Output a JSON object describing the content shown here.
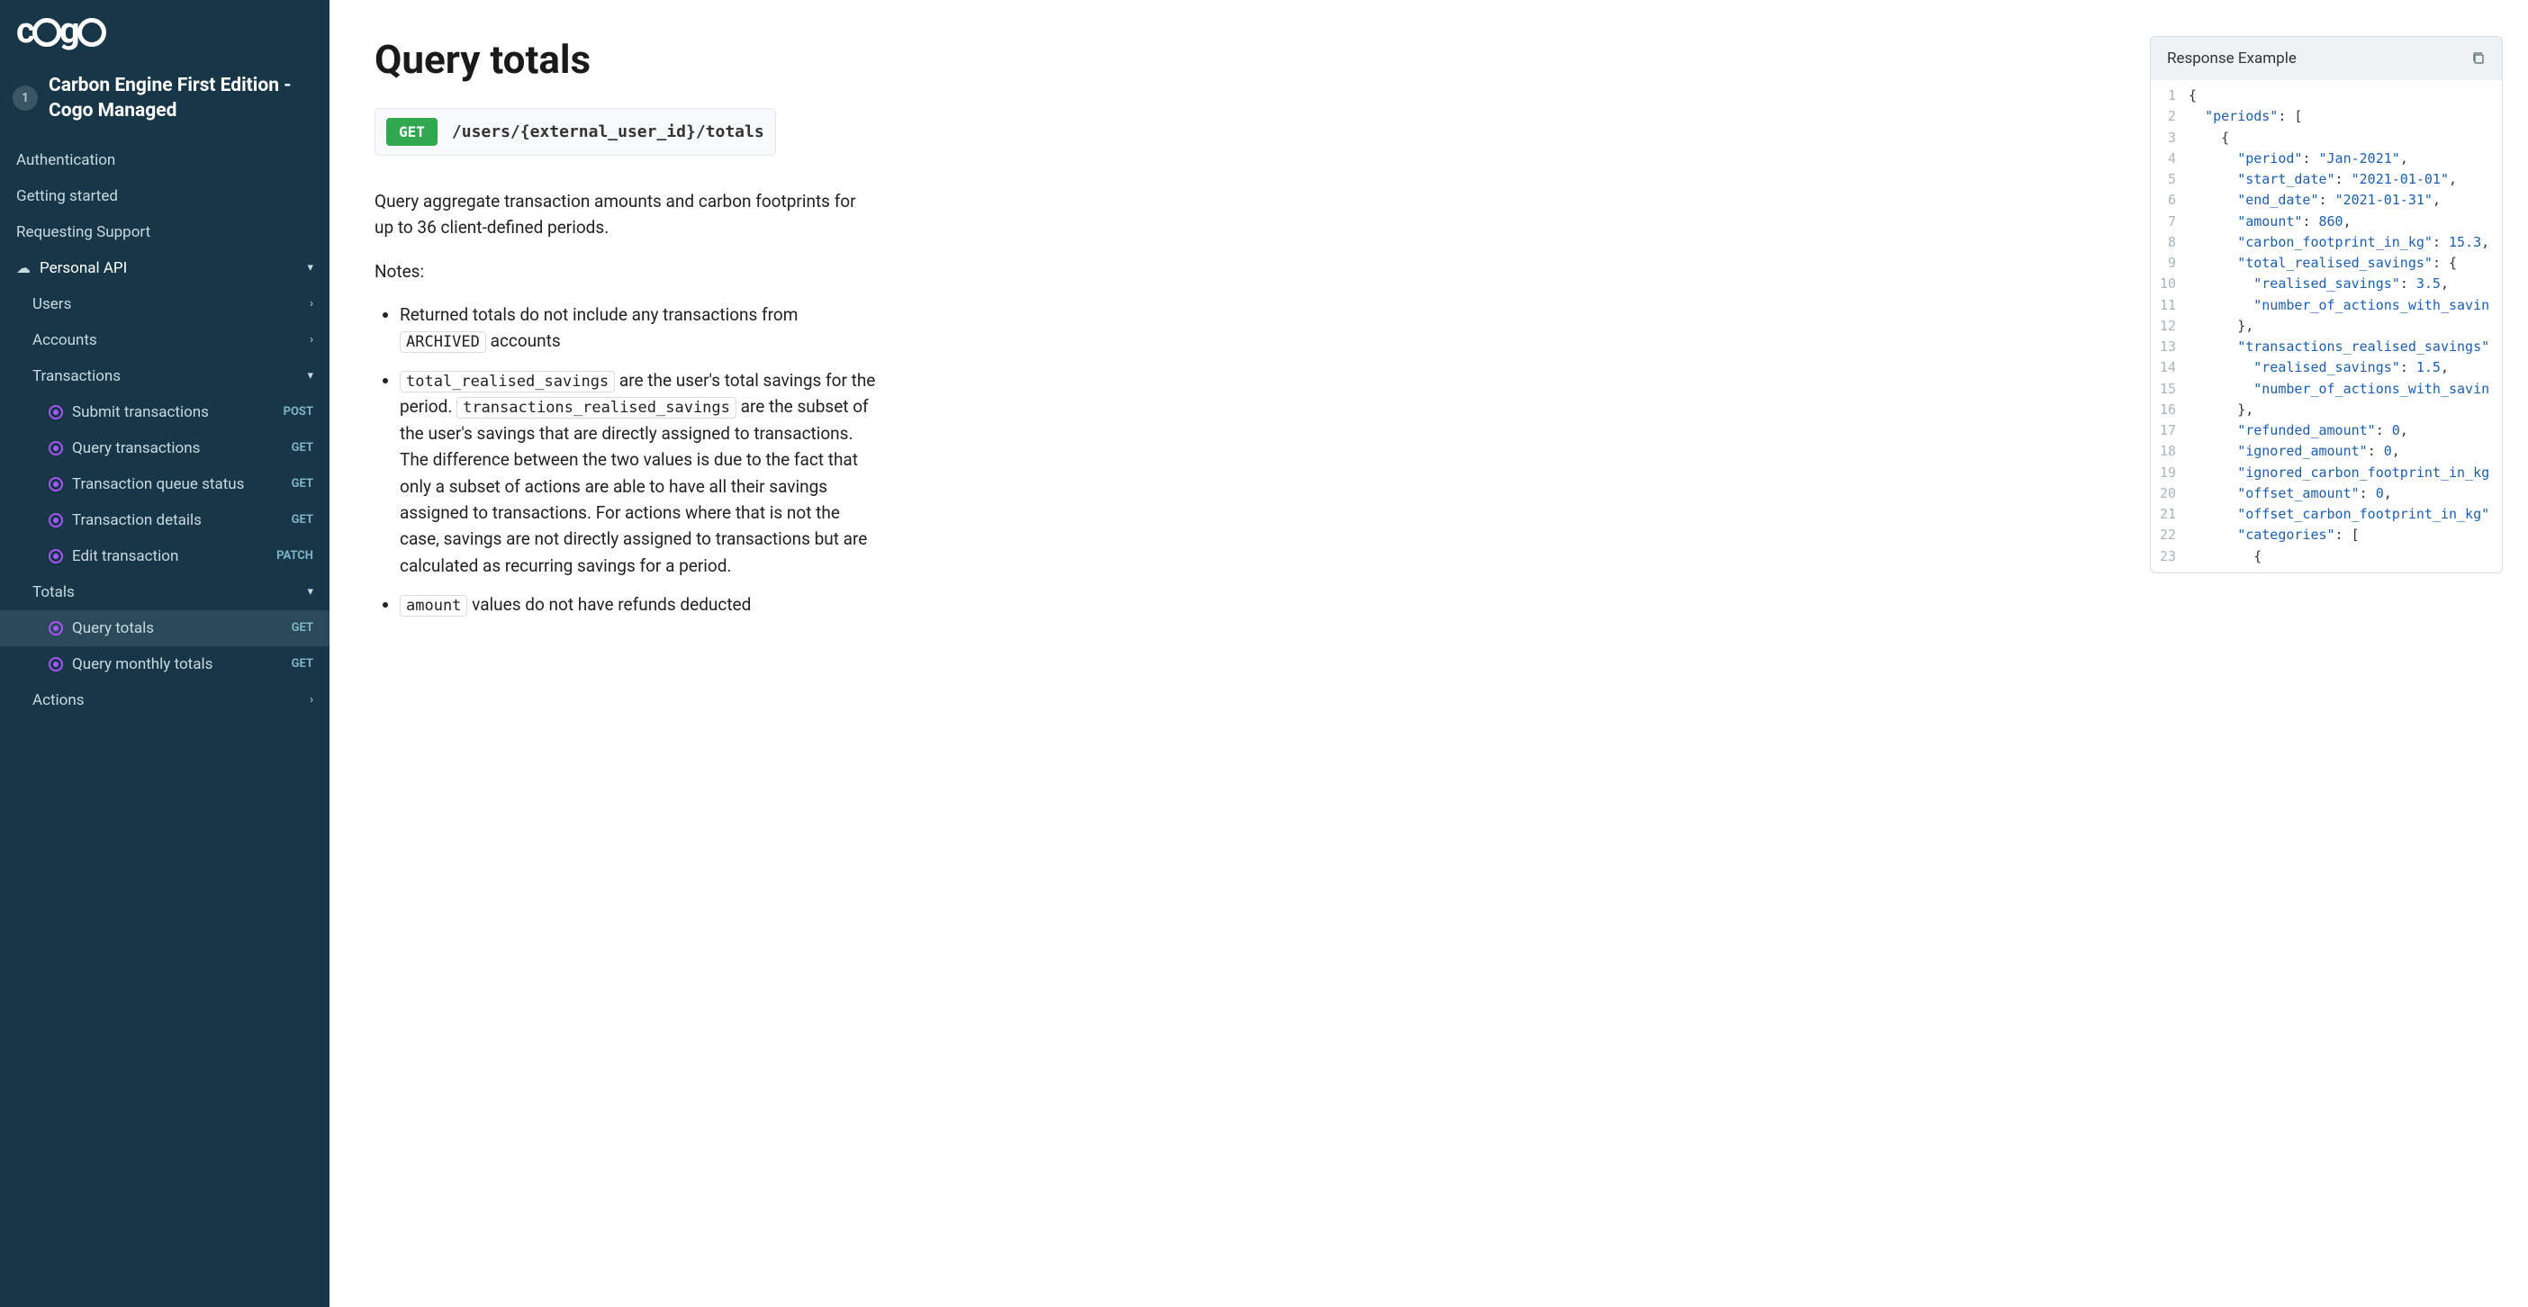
{
  "logo_text": "cogo",
  "env": {
    "badge": "1",
    "name": "Carbon Engine First Edition - Cogo Managed"
  },
  "nav": {
    "top": [
      {
        "label": "Authentication"
      },
      {
        "label": "Getting started"
      },
      {
        "label": "Requesting Support"
      }
    ],
    "section": {
      "label": "Personal API"
    },
    "users": {
      "label": "Users"
    },
    "accounts": {
      "label": "Accounts"
    },
    "transactions": {
      "label": "Transactions",
      "items": [
        {
          "label": "Submit transactions",
          "method": "POST"
        },
        {
          "label": "Query transactions",
          "method": "GET"
        },
        {
          "label": "Transaction queue status",
          "method": "GET"
        },
        {
          "label": "Transaction details",
          "method": "GET"
        },
        {
          "label": "Edit transaction",
          "method": "PATCH"
        }
      ]
    },
    "totals": {
      "label": "Totals",
      "items": [
        {
          "label": "Query totals",
          "method": "GET",
          "active": true
        },
        {
          "label": "Query monthly totals",
          "method": "GET"
        }
      ]
    },
    "actions": {
      "label": "Actions"
    }
  },
  "page": {
    "title": "Query totals",
    "method": "GET",
    "path": "/users/{external_user_id}/totals",
    "description": "Query aggregate transaction amounts and carbon footprints for up to 36 client-defined periods.",
    "notes_label": "Notes:",
    "bullet1_a": "Returned totals do not include any transactions from ",
    "bullet1_code": "ARCHIVED",
    "bullet1_b": " accounts",
    "bullet2_code1": "total_realised_savings",
    "bullet2_a": " are the user's total savings for the period. ",
    "bullet2_code2": "transactions_realised_savings",
    "bullet2_b": " are the subset of the user's savings that are directly assigned to transactions. The difference between the two values is due to the fact that only a subset of actions are able to have all their savings assigned to transactions. For actions where that is not the case, savings are not directly assigned to transactions but are calculated as recurring savings for a period.",
    "bullet3_code": "amount",
    "bullet3_a": " values do not have refunds deducted"
  },
  "response": {
    "header": "Response Example",
    "lines": [
      {
        "n": "1",
        "indent": 0,
        "tokens": [
          [
            "punc",
            "{"
          ]
        ]
      },
      {
        "n": "2",
        "indent": 1,
        "tokens": [
          [
            "key",
            "\"periods\""
          ],
          [
            "punc",
            ": ["
          ]
        ]
      },
      {
        "n": "3",
        "indent": 2,
        "tokens": [
          [
            "punc",
            "{"
          ]
        ]
      },
      {
        "n": "4",
        "indent": 3,
        "tokens": [
          [
            "key",
            "\"period\""
          ],
          [
            "punc",
            ": "
          ],
          [
            "str",
            "\"Jan-2021\""
          ],
          [
            "punc",
            ","
          ]
        ]
      },
      {
        "n": "5",
        "indent": 3,
        "tokens": [
          [
            "key",
            "\"start_date\""
          ],
          [
            "punc",
            ": "
          ],
          [
            "str",
            "\"2021-01-01\""
          ],
          [
            "punc",
            ","
          ]
        ]
      },
      {
        "n": "6",
        "indent": 3,
        "tokens": [
          [
            "key",
            "\"end_date\""
          ],
          [
            "punc",
            ": "
          ],
          [
            "str",
            "\"2021-01-31\""
          ],
          [
            "punc",
            ","
          ]
        ]
      },
      {
        "n": "7",
        "indent": 3,
        "tokens": [
          [
            "key",
            "\"amount\""
          ],
          [
            "punc",
            ": "
          ],
          [
            "num",
            "860"
          ],
          [
            "punc",
            ","
          ]
        ]
      },
      {
        "n": "8",
        "indent": 3,
        "tokens": [
          [
            "key",
            "\"carbon_footprint_in_kg\""
          ],
          [
            "punc",
            ": "
          ],
          [
            "num",
            "15.3"
          ],
          [
            "punc",
            ","
          ]
        ]
      },
      {
        "n": "9",
        "indent": 3,
        "tokens": [
          [
            "key",
            "\"total_realised_savings\""
          ],
          [
            "punc",
            ": {"
          ]
        ]
      },
      {
        "n": "10",
        "indent": 4,
        "tokens": [
          [
            "key",
            "\"realised_savings\""
          ],
          [
            "punc",
            ": "
          ],
          [
            "num",
            "3.5"
          ],
          [
            "punc",
            ","
          ]
        ]
      },
      {
        "n": "11",
        "indent": 4,
        "tokens": [
          [
            "key",
            "\"number_of_actions_with_savin"
          ]
        ]
      },
      {
        "n": "12",
        "indent": 3,
        "tokens": [
          [
            "punc",
            "},"
          ]
        ]
      },
      {
        "n": "13",
        "indent": 3,
        "tokens": [
          [
            "key",
            "\"transactions_realised_savings\""
          ]
        ]
      },
      {
        "n": "14",
        "indent": 4,
        "tokens": [
          [
            "key",
            "\"realised_savings\""
          ],
          [
            "punc",
            ": "
          ],
          [
            "num",
            "1.5"
          ],
          [
            "punc",
            ","
          ]
        ]
      },
      {
        "n": "15",
        "indent": 4,
        "tokens": [
          [
            "key",
            "\"number_of_actions_with_savin"
          ]
        ]
      },
      {
        "n": "16",
        "indent": 3,
        "tokens": [
          [
            "punc",
            "},"
          ]
        ]
      },
      {
        "n": "17",
        "indent": 3,
        "tokens": [
          [
            "key",
            "\"refunded_amount\""
          ],
          [
            "punc",
            ": "
          ],
          [
            "num",
            "0"
          ],
          [
            "punc",
            ","
          ]
        ]
      },
      {
        "n": "18",
        "indent": 3,
        "tokens": [
          [
            "key",
            "\"ignored_amount\""
          ],
          [
            "punc",
            ": "
          ],
          [
            "num",
            "0"
          ],
          [
            "punc",
            ","
          ]
        ]
      },
      {
        "n": "19",
        "indent": 3,
        "tokens": [
          [
            "key",
            "\"ignored_carbon_footprint_in_kg"
          ]
        ]
      },
      {
        "n": "20",
        "indent": 3,
        "tokens": [
          [
            "key",
            "\"offset_amount\""
          ],
          [
            "punc",
            ": "
          ],
          [
            "num",
            "0"
          ],
          [
            "punc",
            ","
          ]
        ]
      },
      {
        "n": "21",
        "indent": 3,
        "tokens": [
          [
            "key",
            "\"offset_carbon_footprint_in_kg\""
          ]
        ]
      },
      {
        "n": "22",
        "indent": 3,
        "tokens": [
          [
            "key",
            "\"categories\""
          ],
          [
            "punc",
            ": ["
          ]
        ]
      },
      {
        "n": "23",
        "indent": 4,
        "tokens": [
          [
            "punc",
            "{"
          ]
        ]
      }
    ]
  }
}
